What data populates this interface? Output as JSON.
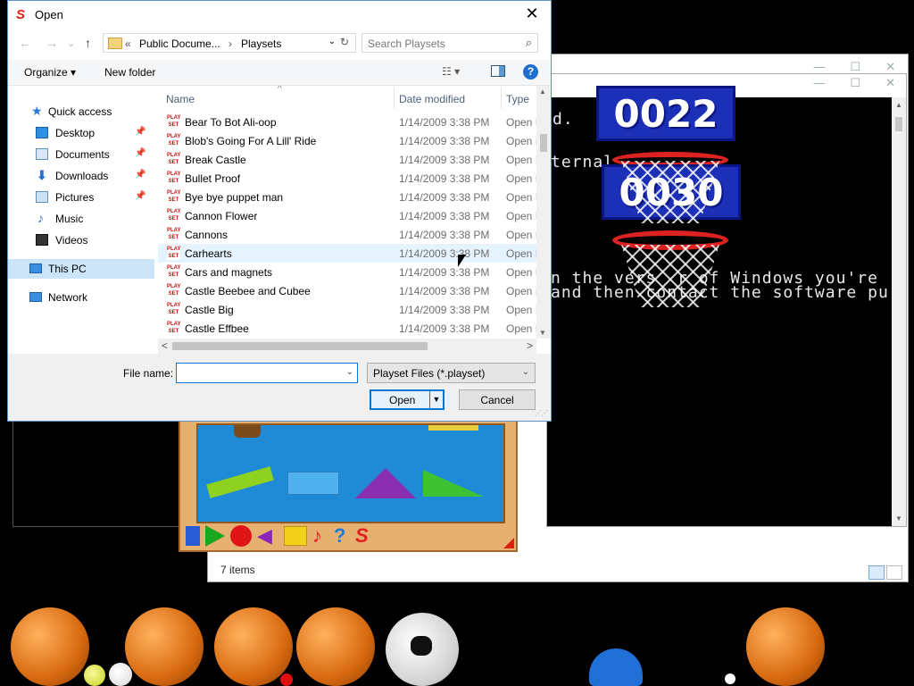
{
  "dialog": {
    "title": "Open",
    "close_glyph": "✕",
    "nav": {
      "back": "←",
      "forward": "→",
      "dropdown": "⌄",
      "up": "↑"
    },
    "address": {
      "prefix": "«",
      "crumb1": "Public Docume...",
      "sep": "›",
      "crumb2": "Playsets",
      "dropdown": "⌄",
      "refresh": "↻"
    },
    "search": {
      "placeholder": "Search Playsets",
      "icon": "search-icon"
    },
    "toolbar": {
      "organize": "Organize ▾",
      "new_folder": "New folder",
      "view": "☷ ▾",
      "help": "?"
    },
    "nav_pane": [
      {
        "label": "Quick access",
        "icon": "star-icon",
        "color": "#2f77d8"
      },
      {
        "label": "Desktop",
        "icon": "desktop-icon",
        "color": "#2f8fe0",
        "pinned": true
      },
      {
        "label": "Documents",
        "icon": "documents-icon",
        "color": "#5f8fc0",
        "pinned": true
      },
      {
        "label": "Downloads",
        "icon": "downloads-icon",
        "color": "#2a6fd1",
        "pinned": true
      },
      {
        "label": "Pictures",
        "icon": "pictures-icon",
        "color": "#5a8fbf",
        "pinned": true
      },
      {
        "label": "Music",
        "icon": "music-icon",
        "color": "#2a6fd1"
      },
      {
        "label": "Videos",
        "icon": "videos-icon",
        "color": "#444"
      },
      {
        "label": "This PC",
        "icon": "computer-icon",
        "color": "#3a8ee0",
        "selected": true
      },
      {
        "label": "Network",
        "icon": "network-icon",
        "color": "#3a8ee0"
      }
    ],
    "columns": {
      "name": "Name",
      "date": "Date modified",
      "type": "Type",
      "sort": "^"
    },
    "files": [
      {
        "name": "Bear To Bot Ali-oop",
        "date": "1/14/2009 3:38 PM",
        "type": "Open I"
      },
      {
        "name": "Blob's Going For A Lill' Ride",
        "date": "1/14/2009 3:38 PM",
        "type": "Open I"
      },
      {
        "name": "Break Castle",
        "date": "1/14/2009 3:38 PM",
        "type": "Open I"
      },
      {
        "name": "Bullet Proof",
        "date": "1/14/2009 3:38 PM",
        "type": "Open I"
      },
      {
        "name": "Bye bye puppet man",
        "date": "1/14/2009 3:38 PM",
        "type": "Open I"
      },
      {
        "name": "Cannon Flower",
        "date": "1/14/2009 3:38 PM",
        "type": "Open I"
      },
      {
        "name": "Cannons",
        "date": "1/14/2009 3:38 PM",
        "type": "Open I"
      },
      {
        "name": "Carhearts",
        "date": "1/14/2009 3:38 PM",
        "type": "Open I",
        "hover": true
      },
      {
        "name": "Cars and magnets",
        "date": "1/14/2009 3:38 PM",
        "type": "Open I"
      },
      {
        "name": "Castle Beebee and Cubee",
        "date": "1/14/2009 3:38 PM",
        "type": "Open I"
      },
      {
        "name": "Castle Big",
        "date": "1/14/2009 3:38 PM",
        "type": "Open I"
      },
      {
        "name": "Castle Effbee",
        "date": "1/14/2009 3:38 PM",
        "type": "Open I"
      }
    ],
    "file_icon_text": "PLAY SET",
    "scroll": {
      "up": "▲",
      "down": "▼",
      "left": "<",
      "right": ">"
    },
    "file_name_label": "File name:",
    "file_name_value": "",
    "file_type": "Playset Files (*.playset)",
    "open_label": "Open",
    "cancel_label": "Cancel"
  },
  "console": {
    "lines": [
      "d.",
      "ternal",
      "",
      "",
      "",
      "n the vers  r of Windows you're",
      "and then contact the software pu"
    ]
  },
  "game": {
    "score_top": "0022",
    "score_bottom": "0030"
  },
  "background_explorer": {
    "status": "7 items"
  }
}
